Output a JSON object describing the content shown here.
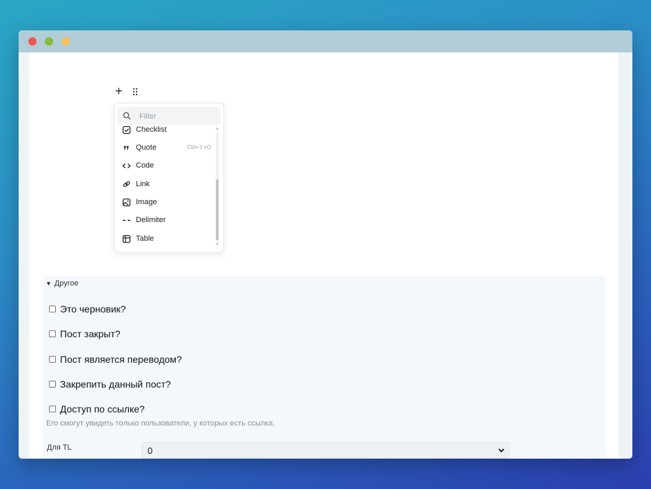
{
  "editor": {
    "plus_glyph": "+",
    "popover": {
      "filter_placeholder": "Filter",
      "items": [
        {
          "label": "Checklist",
          "icon": "checklist-icon",
          "shortcut": ""
        },
        {
          "label": "Quote",
          "icon": "quote-icon",
          "shortcut": "Ctrl+⇧+O"
        },
        {
          "label": "Code",
          "icon": "code-icon",
          "shortcut": ""
        },
        {
          "label": "Link",
          "icon": "link-icon",
          "shortcut": ""
        },
        {
          "label": "Image",
          "icon": "image-icon",
          "shortcut": ""
        },
        {
          "label": "Delimiter",
          "icon": "delimiter-icon",
          "shortcut": ""
        },
        {
          "label": "Table",
          "icon": "table-icon",
          "shortcut": ""
        }
      ]
    }
  },
  "other": {
    "summary": "Другое",
    "checkboxes": [
      {
        "label": "Это черновик?",
        "checked": false
      },
      {
        "label": "Пост закрыт?",
        "checked": false
      },
      {
        "label": "Пост является переводом?",
        "checked": false
      },
      {
        "label": "Закрепить данный пост?",
        "checked": false
      },
      {
        "label": "Доступ по ссылке?",
        "checked": false
      }
    ],
    "link_hint": "Его смогут увидеть только пользователи, у которых есть ссылка.",
    "tl_label": "Для TL",
    "tl_value": "0"
  },
  "colors": {
    "window_titlebar": "#b0cdd8",
    "close": "#f25556",
    "minimize": "#83bd3b",
    "maximize": "#f7bd57",
    "details_bg": "#f4f8fc"
  }
}
